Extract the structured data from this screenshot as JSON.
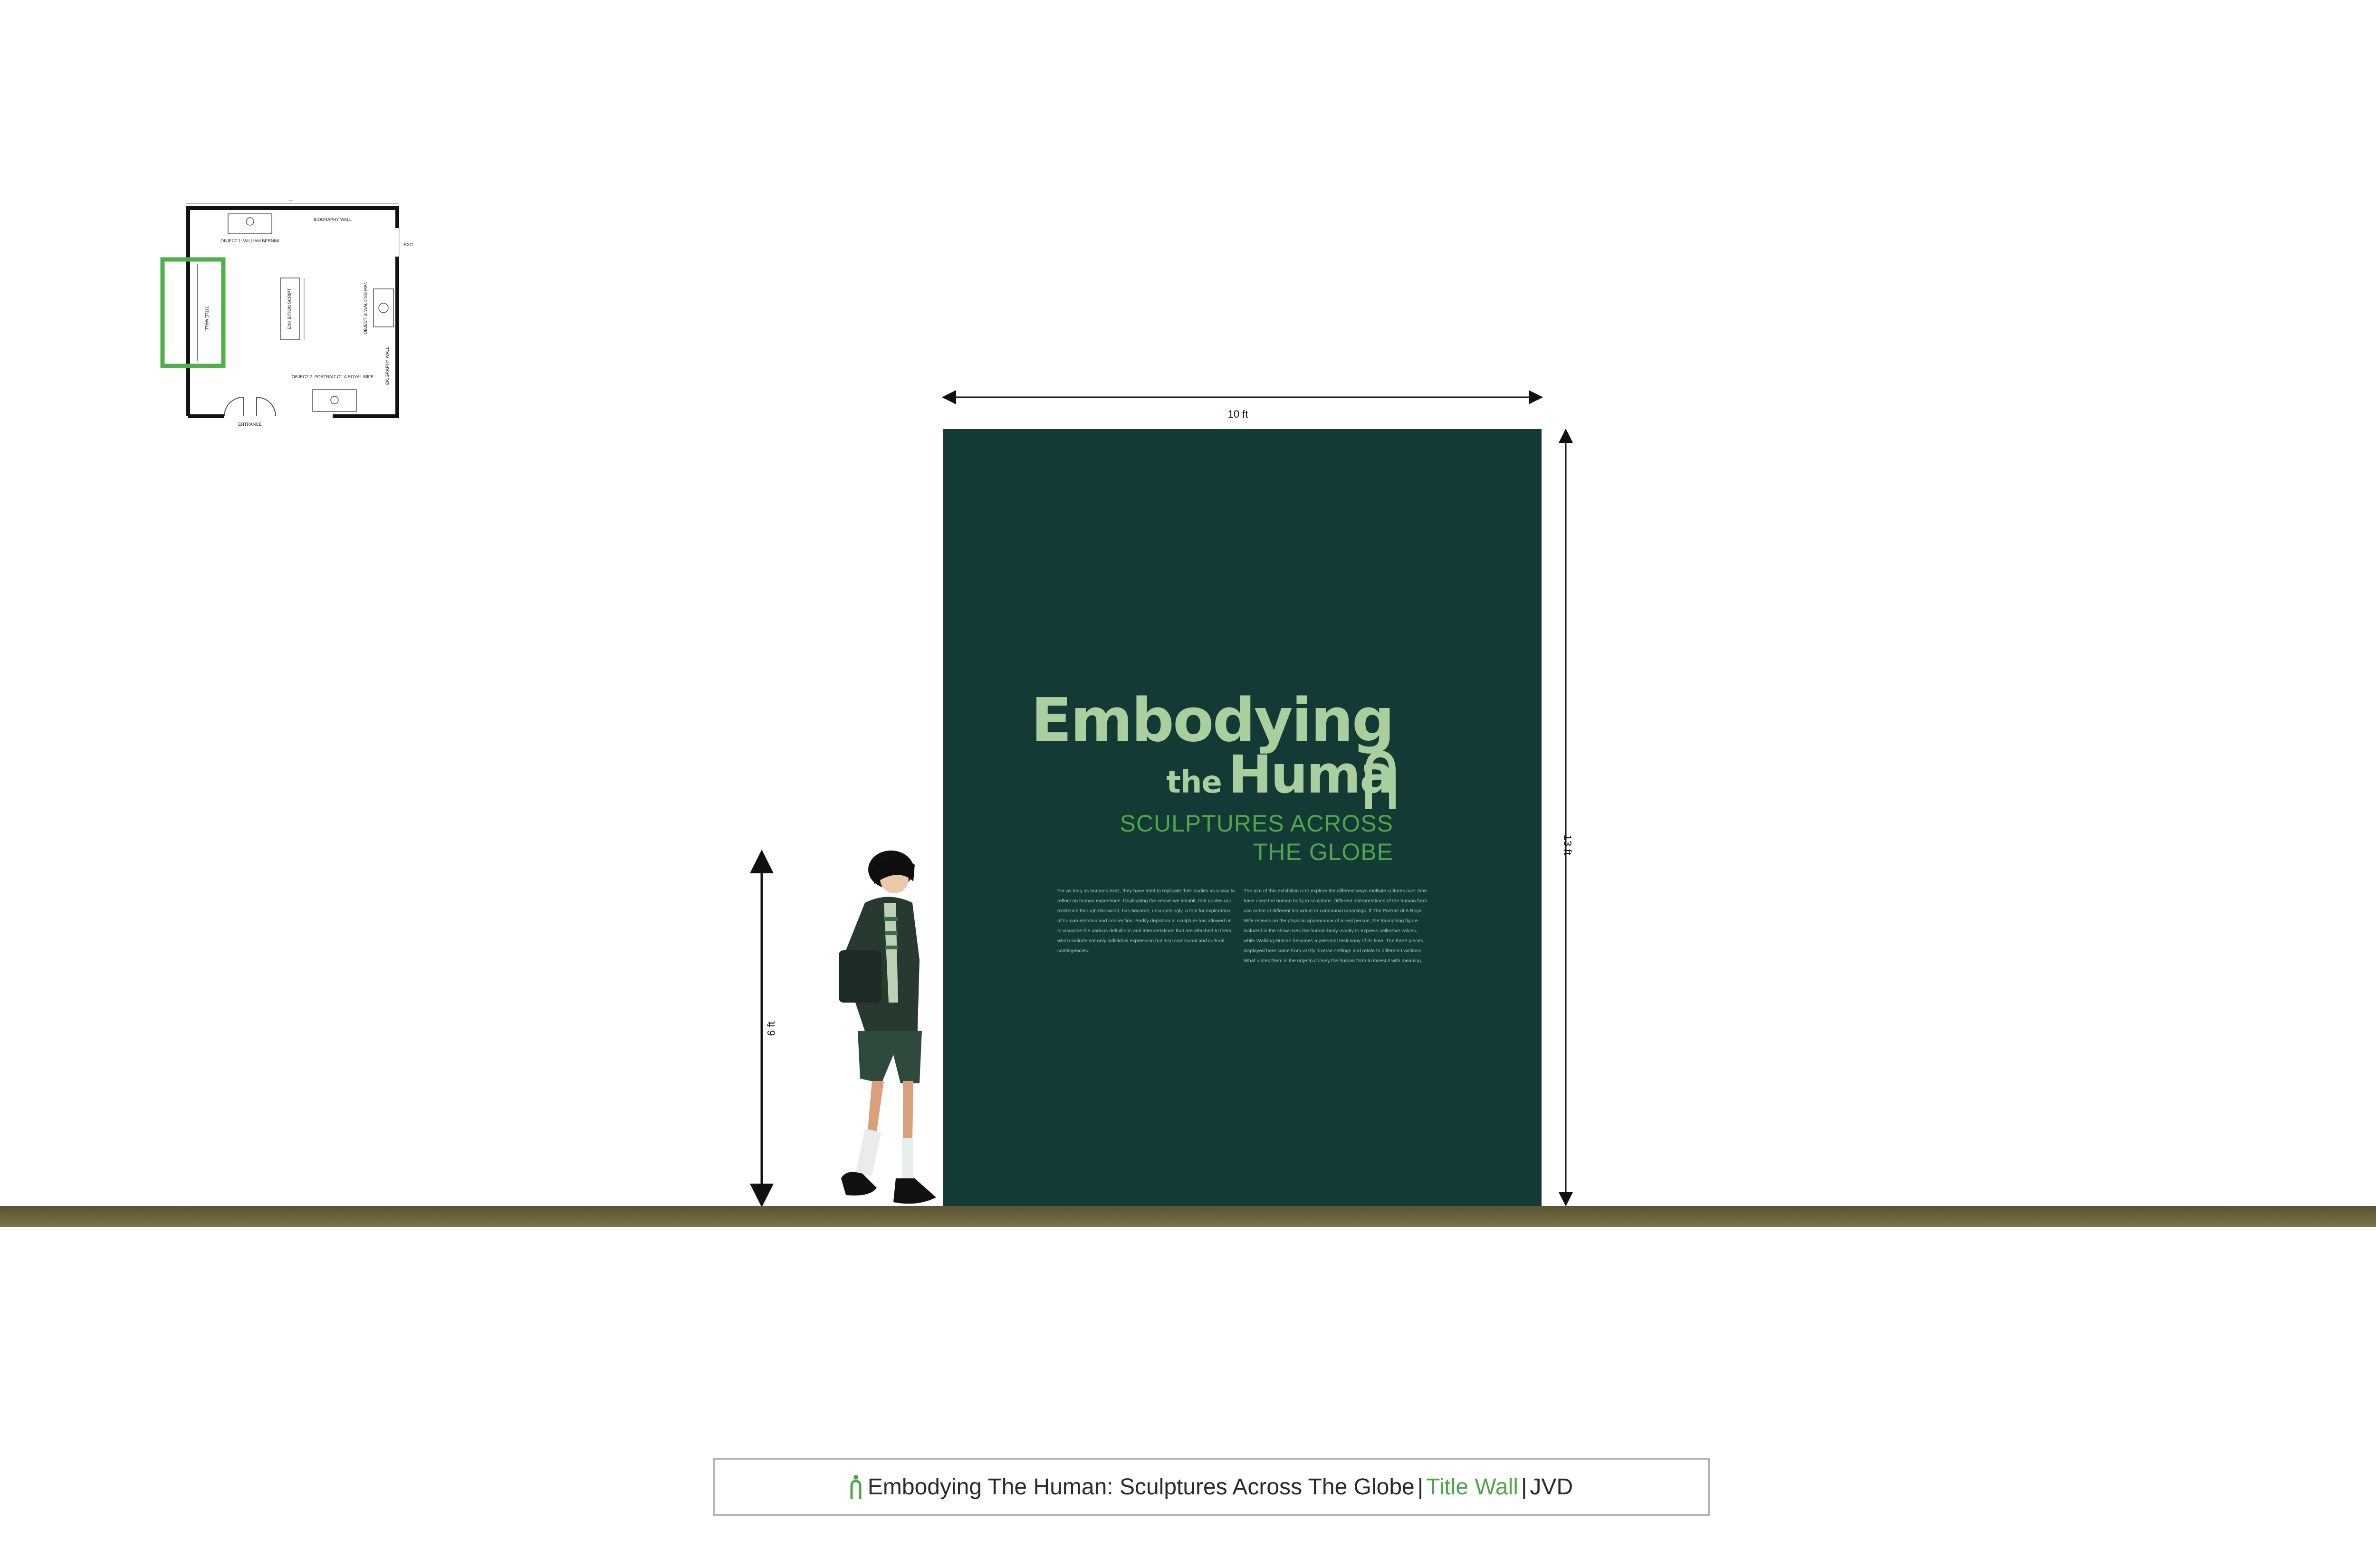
{
  "floor_plan": {
    "labels": {
      "top_wall": "BIOGRAPHY WALL",
      "object1": "OBJECT 1: WILLIAM BERNINI",
      "exit": "EXIT",
      "title_wall": "TITLE WALL",
      "center": "EXHIBITION SCRIPT",
      "object3": "OBJECT 3: WALKING MAN",
      "right_wall": "BIOGRAPHY WALL",
      "object2": "OBJECT 2: PORTRAIT OF A ROYAL WIFE",
      "entrance": "ENTRANCE"
    },
    "highlight_color": "#4fb04a"
  },
  "wall": {
    "width_label": "10 ft",
    "height_label": "13 ft",
    "color": "#143a36",
    "title_line1": "Embodying",
    "title_the": "the",
    "title_human": "Huma",
    "subtitle": "SCULPTURES ACROSS\nTHE GLOBE",
    "body_left": "For as long as humans exist, they have tried to replicate their bodies as a way to reflect on human experience. Duplicating the vessel we inhabit, that guides our existence through this world, has become, unsurprisingly, a tool for exploration of human emotion and connection. Bodily depiction in sculpture has allowed us to visualize the various definitions and interpretations that are attached to them, which include not only individual expression but also communal and cultural contingencies.",
    "body_right": "The aim of this exhibition is to explore the different ways multiple cultures over time have used the human body in sculpture. Different interpretations of the human form can arrive at different individual or communal meanings. If The Portrait of A Royal Wife reveals on the physical appearance of a real person, the triumphing figure included in the show uses the human body mostly to express collective values, while Walking Human becomes a personal testimony of its time. The three pieces displayed here come from vastly diverse settings and relate to different traditions. What unites them is the urge to convey the human form to invest it with meaning."
  },
  "person": {
    "height_label": "6 ft"
  },
  "caption": {
    "title": "Embodying The Human: Sculptures Across The Globe",
    "separator": "|",
    "highlight": "Title Wall",
    "separator2": "|",
    "author": "JVD",
    "accent_color": "#4fa54c"
  }
}
